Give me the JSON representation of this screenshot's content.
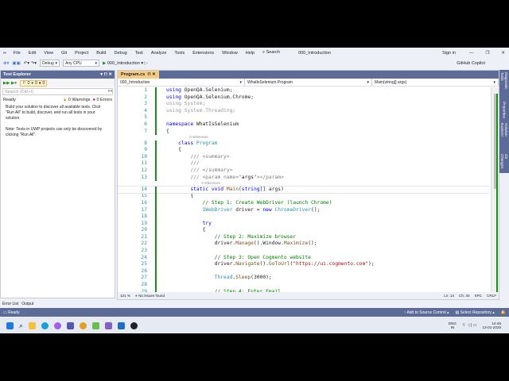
{
  "titlebar": {
    "menus": [
      "File",
      "Edit",
      "View",
      "Git",
      "Project",
      "Build",
      "Debug",
      "Test",
      "Analyze",
      "Tools",
      "Extensions",
      "Window",
      "Help"
    ],
    "search": "Search",
    "solution": "000_Introduction",
    "sign_in": "Sign in"
  },
  "toolbar": {
    "config": "Debug",
    "platform": "Any CPU",
    "run": "000_Introduction",
    "copilot": "GitHub Copilot"
  },
  "test_explorer": {
    "title": "Test Explorer",
    "counts": [
      "0",
      "0",
      "0"
    ],
    "search_placeholder": "Search (Ctrl+I)",
    "status": "Ready",
    "warnings": "0 Warnings",
    "errors": "0 Errors",
    "msg1": "Build your solution to discover all available tests. Click \"Run All\" to build, discover, and run all tests in your solution.",
    "msg2": "Note: Tests in UWP projects can only be discovered by clicking \"Run All\"."
  },
  "editor": {
    "tab": "Program.cs",
    "nav": [
      "000_Introduction",
      "WhatIsSelenium.Program",
      "Main(string[] args)"
    ],
    "lines": [
      {
        "n": "1",
        "t": [
          [
            "using",
            "kw"
          ],
          [
            " OpenQA.Selenium;",
            ""
          ]
        ]
      },
      {
        "n": "2",
        "t": [
          [
            "using",
            "kw"
          ],
          [
            " OpenQA.Selenium.Chrome;",
            ""
          ]
        ]
      },
      {
        "n": "3",
        "t": [
          [
            "using System;",
            "gr"
          ]
        ]
      },
      {
        "n": "4",
        "t": [
          [
            "using System.Threading;",
            "gr"
          ]
        ]
      },
      {
        "n": "5",
        "t": []
      },
      {
        "n": "6",
        "t": [
          [
            "namespace",
            "kw"
          ],
          [
            " WhatIsSelenium",
            ""
          ]
        ]
      },
      {
        "n": "7",
        "t": [
          [
            "{",
            ""
          ]
        ]
      },
      {
        "ref": "0 references",
        "indent": 4
      },
      {
        "n": "8",
        "t": [
          [
            "    class",
            "kw"
          ],
          [
            " Program",
            "ty"
          ]
        ]
      },
      {
        "n": "9",
        "t": [
          [
            "    {",
            ""
          ]
        ]
      },
      {
        "n": "10",
        "t": [
          [
            "        /// <summary>",
            "xml"
          ]
        ]
      },
      {
        "n": "11",
        "t": [
          [
            "        ///",
            "xml"
          ]
        ]
      },
      {
        "n": "12",
        "t": [
          [
            "        /// </summary>",
            "xml"
          ]
        ]
      },
      {
        "n": "13",
        "t": [
          [
            "        /// <param name=\"",
            "xml"
          ],
          [
            "args",
            ""
          ],
          [
            "\"></param>",
            "xml"
          ]
        ]
      },
      {
        "ref": "0 references",
        "indent": 8
      },
      {
        "n": "14",
        "t": [
          [
            "        static void",
            "kw"
          ],
          [
            " Main",
            "me"
          ],
          [
            "(",
            ""
          ],
          [
            "string",
            "kw"
          ],
          [
            "[] args)",
            ""
          ]
        ]
      },
      {
        "n": "15",
        "t": [
          [
            "        {",
            ""
          ]
        ]
      },
      {
        "n": "16",
        "t": [
          [
            "            // Step 1: Create WebDriver (launch Chrome)",
            "cm"
          ]
        ]
      },
      {
        "n": "17",
        "t": [
          [
            "            IWebDriver",
            "ty"
          ],
          [
            " driver = ",
            ""
          ],
          [
            "new",
            "kw"
          ],
          [
            " ChromeDriver",
            "ty"
          ],
          [
            "();",
            ""
          ]
        ]
      },
      {
        "n": "18",
        "t": []
      },
      {
        "n": "19",
        "t": [
          [
            "            try",
            "kw"
          ]
        ]
      },
      {
        "n": "20",
        "t": [
          [
            "            {",
            ""
          ]
        ]
      },
      {
        "n": "21",
        "t": [
          [
            "                // Step 2: Maximize browser",
            "cm"
          ]
        ]
      },
      {
        "n": "22",
        "t": [
          [
            "                driver.",
            ""
          ],
          [
            "Manage",
            "me"
          ],
          [
            "().Window.",
            ""
          ],
          [
            "Maximize",
            "me"
          ],
          [
            "();",
            ""
          ]
        ]
      },
      {
        "n": "23",
        "t": []
      },
      {
        "n": "24",
        "t": [
          [
            "                // Step 3: Open Cogmento website",
            "cm"
          ]
        ]
      },
      {
        "n": "25",
        "t": [
          [
            "                driver.",
            ""
          ],
          [
            "Navigate",
            "me"
          ],
          [
            "().",
            ""
          ],
          [
            "GoToUrl",
            "me"
          ],
          [
            "(",
            ""
          ],
          [
            "\"https://ui.cogmento.com\"",
            "st"
          ],
          [
            ");",
            ""
          ]
        ]
      },
      {
        "n": "26",
        "t": []
      },
      {
        "n": "27",
        "t": [
          [
            "                Thread",
            "ty"
          ],
          [
            ".",
            ""
          ],
          [
            "Sleep",
            "me"
          ],
          [
            "(3000);",
            ""
          ]
        ]
      },
      {
        "n": "28",
        "t": []
      },
      {
        "n": "29",
        "t": [
          [
            "                // Step 4: Enter Email",
            "cm"
          ]
        ]
      }
    ],
    "zoom": "121 %",
    "issues": "No issues found",
    "ln": "Ln: 14",
    "ch": "Ch: 40",
    "spc": "SPC",
    "crlf": "CRLF"
  },
  "right_tabs": [
    "Diagnostic Tools",
    "Properties",
    "Solution Explorer",
    "Git Changes"
  ],
  "bottom_tabs": [
    "Error List",
    "Output"
  ],
  "status": {
    "ready": "Ready",
    "source_control": "Add to Source Control",
    "repo": "Select Repository"
  },
  "taskbar": {
    "lang": "ENG",
    "region": "IN",
    "time": "14:46",
    "date": "13-01-2026"
  }
}
